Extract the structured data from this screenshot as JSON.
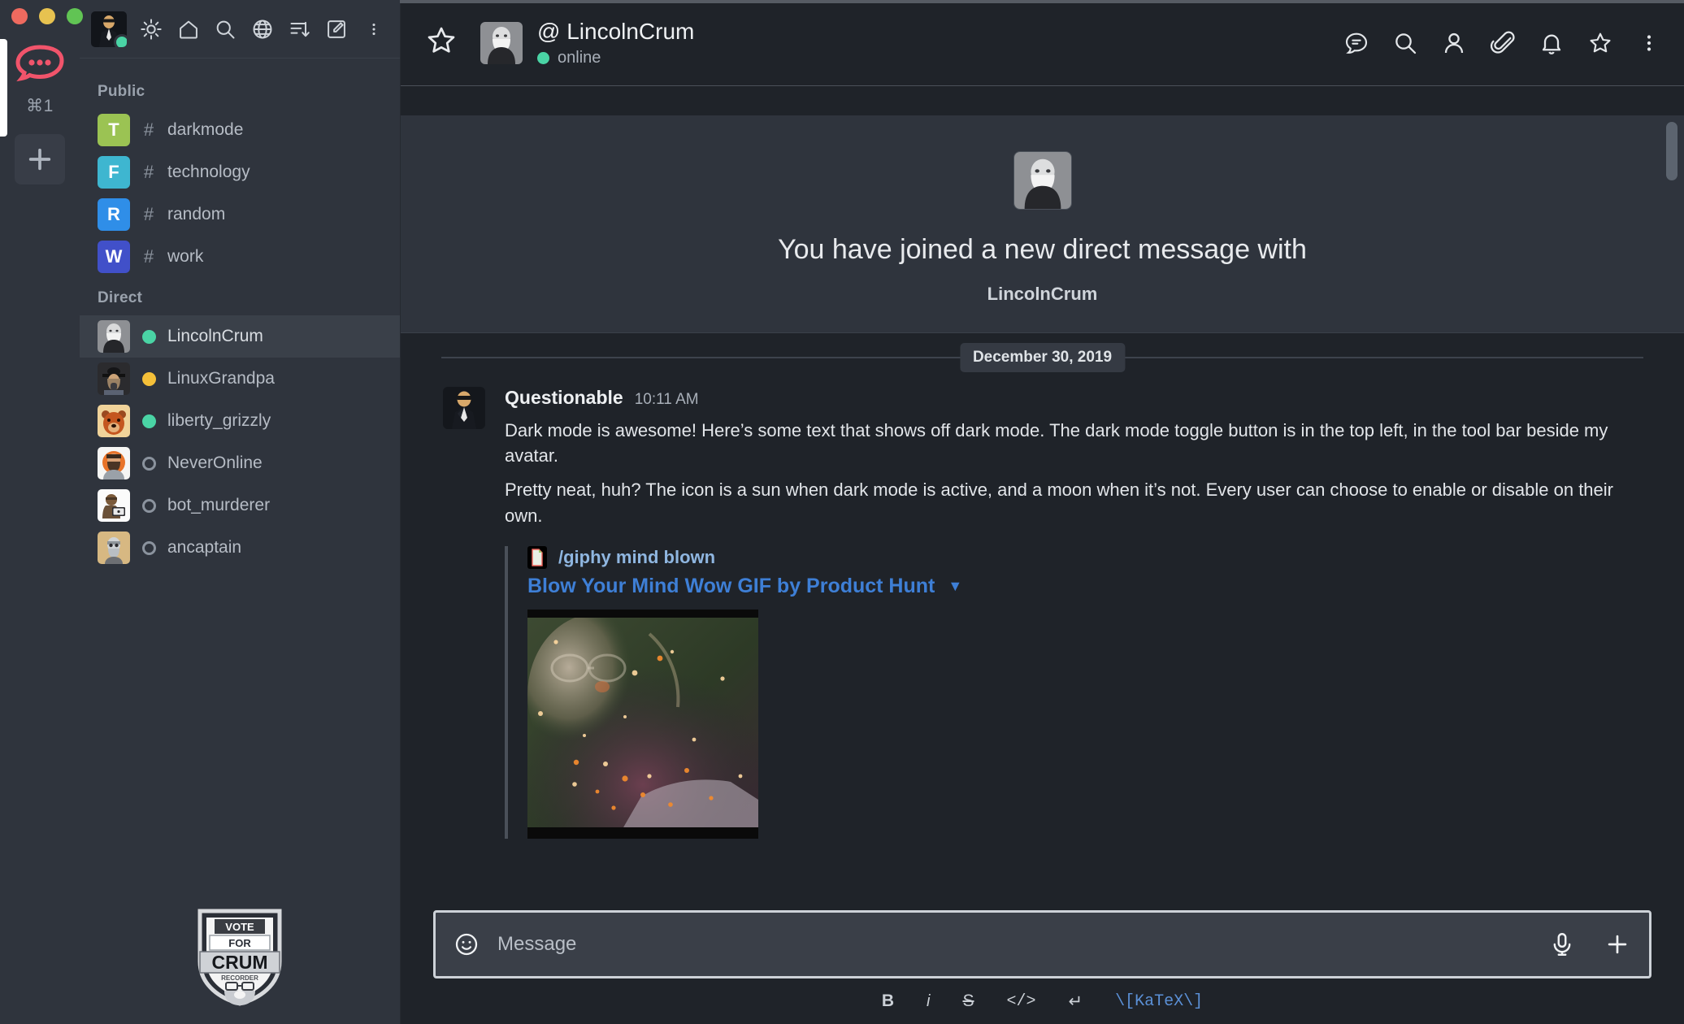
{
  "window": {
    "traffic_lights": [
      "close",
      "minimize",
      "zoom"
    ]
  },
  "rail": {
    "shortcut_label": "⌘1",
    "add_label": "+",
    "logo_name": "rocket-chat-logo"
  },
  "sidebar": {
    "toolbar": {
      "avatar_alt": "Questionable",
      "status": "online",
      "icons": [
        {
          "name": "sun-icon",
          "label": "Toggle dark mode"
        },
        {
          "name": "home-icon",
          "label": "Home"
        },
        {
          "name": "search-icon",
          "label": "Search"
        },
        {
          "name": "globe-icon",
          "label": "Directory"
        },
        {
          "name": "sort-icon",
          "label": "Sort"
        },
        {
          "name": "pencil-square-icon",
          "label": "Create new"
        },
        {
          "name": "kebab-menu-icon",
          "label": "Options"
        }
      ]
    },
    "groups": [
      {
        "title": "Public",
        "items": [
          {
            "initial": "T",
            "color": "#9bc353",
            "prefix": "#",
            "label": "darkmode",
            "active": false
          },
          {
            "initial": "F",
            "color": "#3eb6d0",
            "prefix": "#",
            "label": "technology",
            "active": false
          },
          {
            "initial": "R",
            "color": "#2f8ee8",
            "prefix": "#",
            "label": "random",
            "active": false
          },
          {
            "initial": "W",
            "color": "#4150c9",
            "prefix": "#",
            "label": "work",
            "active": false
          }
        ]
      },
      {
        "title": "Direct",
        "items": [
          {
            "label": "LincolnCrum",
            "status": "online",
            "status_color": "#4ad4a5",
            "active": true,
            "avatar": "lincolncrum"
          },
          {
            "label": "LinuxGrandpa",
            "status": "away",
            "status_color": "#f5c039",
            "active": false,
            "avatar": "linuxgrandpa"
          },
          {
            "label": "liberty_grizzly",
            "status": "online",
            "status_color": "#4ad4a5",
            "active": false,
            "avatar": "liberty_grizzly"
          },
          {
            "label": "NeverOnline",
            "status": "offline",
            "status_color": "#8b939e",
            "active": false,
            "avatar": "neveronline"
          },
          {
            "label": "bot_murderer",
            "status": "offline",
            "status_color": "#8b939e",
            "active": false,
            "avatar": "bot_murderer"
          },
          {
            "label": "ancaptain",
            "status": "offline",
            "status_color": "#8b939e",
            "active": false,
            "avatar": "ancaptain"
          }
        ]
      }
    ],
    "footer_badge": {
      "name": "vote-for-crum-badge",
      "line1": "VOTE",
      "line2": "FOR",
      "line3": "CRUM",
      "line4": "RECORDER"
    }
  },
  "header": {
    "username": "@ LincolnCrum",
    "status_text": "online",
    "status_color": "#4ad4a5",
    "favorite_icon": "star-outline-icon",
    "actions": [
      {
        "name": "threads-icon",
        "label": "Threads"
      },
      {
        "name": "search-icon",
        "label": "Search Messages"
      },
      {
        "name": "user-icon",
        "label": "User Info"
      },
      {
        "name": "paperclip-icon",
        "label": "Files"
      },
      {
        "name": "bell-icon",
        "label": "Notifications"
      },
      {
        "name": "star-icon",
        "label": "Starred Messages"
      },
      {
        "name": "kebab-menu-icon",
        "label": "Options"
      }
    ]
  },
  "welcome": {
    "heading": "You have joined a new direct message with",
    "name": "LincolnCrum"
  },
  "conversation": {
    "date_divider": "December 30, 2019",
    "messages": [
      {
        "username": "Questionable",
        "time": "10:11 AM",
        "paragraphs": [
          "Dark mode is awesome! Here’s some text that shows off dark mode. The dark mode toggle button is in the top left, in the tool bar beside my avatar.",
          "Pretty neat, huh? The icon is a sun when dark mode is active, and a moon when it’s not. Every user can choose to enable or disable on their own."
        ],
        "attachment": {
          "command": "/giphy mind blown",
          "title": "Blow Your Mind Wow GIF by Product Hunt",
          "collapse_icon": "chevron-down-icon",
          "doc_icon": "document-icon"
        }
      }
    ]
  },
  "composer": {
    "emoji_icon": "smiley-icon",
    "placeholder": "Message",
    "value": "",
    "audio_icon": "microphone-icon",
    "plus_icon": "plus-icon",
    "format_buttons": [
      {
        "name": "bold-button",
        "label": "B",
        "style": "bold"
      },
      {
        "name": "italic-button",
        "label": "i",
        "style": "italic"
      },
      {
        "name": "strike-button",
        "label": "S",
        "style": "strike"
      },
      {
        "name": "code-button",
        "label": "</>",
        "style": "code"
      },
      {
        "name": "multiline-button",
        "label": "↵",
        "style": "plain"
      },
      {
        "name": "katex-button",
        "label": "\\[KaTeX\\]",
        "style": "katex"
      }
    ]
  }
}
